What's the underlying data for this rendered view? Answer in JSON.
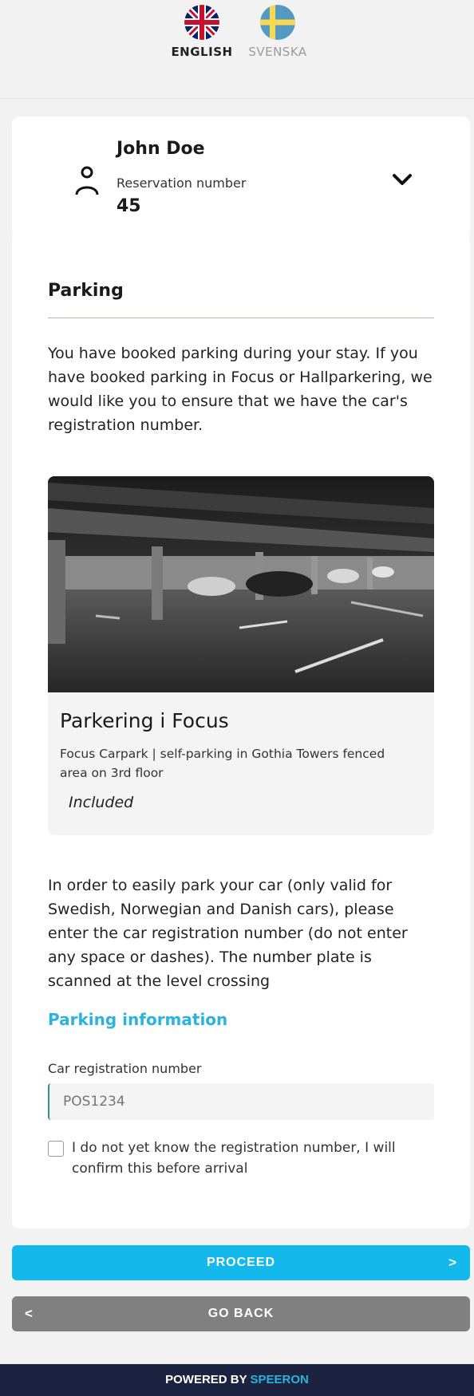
{
  "languages": [
    {
      "code": "en",
      "label": "ENGLISH",
      "active": true
    },
    {
      "code": "sv",
      "label": "SVENSKA",
      "active": false
    }
  ],
  "guest": {
    "name": "John Doe",
    "reservation_label": "Reservation number",
    "reservation_number": "45"
  },
  "parking": {
    "title": "Parking",
    "intro": "You have booked parking during your stay. If you have booked parking in Focus or Hallparkering, we would like you to ensure that we have the car's registration number.",
    "product": {
      "name": "Parkering i Focus",
      "description": "Focus Carpark | self-parking in Gothia Towers fenced area on 3rd floor",
      "price": "Included"
    },
    "instructions": "In order to easily park your car (only valid for Swedish, Norwegian and Danish cars), please enter the car registration number (do not enter any space or dashes). The number plate is scanned at the level crossing",
    "info_link": "Parking information",
    "field_label": "Car registration number",
    "field_placeholder": "POS1234",
    "checkbox_label": "I do not yet know the registration number, I will confirm this before arrival",
    "checkbox_checked": false
  },
  "buttons": {
    "proceed": "PROCEED",
    "proceed_arrow": ">",
    "back": "GO BACK",
    "back_arrow": "<"
  },
  "footer": {
    "prefix": "POWERED BY ",
    "brand": "SPEERON"
  },
  "colors": {
    "accent": "#13b9ea",
    "link": "#2bb3df",
    "back_button": "#808080",
    "footer_bg": "#1b2340"
  }
}
